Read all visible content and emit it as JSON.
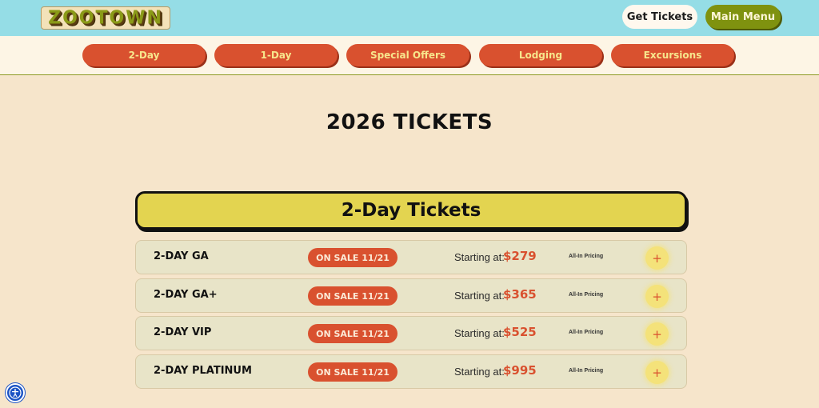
{
  "header": {
    "logo_text": "ZOOTOWN",
    "get_tickets_label": "Get Tickets",
    "main_menu_label": "Main Menu"
  },
  "nav": {
    "items": [
      {
        "label": "2-Day"
      },
      {
        "label": "1-Day"
      },
      {
        "label": "Special Offers"
      },
      {
        "label": "Lodging"
      },
      {
        "label": "Excursions"
      }
    ]
  },
  "main": {
    "page_title": "2026 TICKETS",
    "section_title": "2-Day Tickets",
    "tickets": [
      {
        "name": "2-DAY GA",
        "badge": "ON SALE 11/21",
        "starting_label": "Starting at:",
        "price": "$279",
        "pricing_note": "All-In Pricing",
        "expand_symbol": "+"
      },
      {
        "name": "2-DAY GA+",
        "badge": "ON SALE 11/21",
        "starting_label": "Starting at:",
        "price": "$365",
        "pricing_note": "All-In Pricing",
        "expand_symbol": "+"
      },
      {
        "name": "2-DAY VIP",
        "badge": "ON SALE 11/21",
        "starting_label": "Starting at:",
        "price": "$525",
        "pricing_note": "All-In Pricing",
        "expand_symbol": "+"
      },
      {
        "name": "2-DAY PLATINUM",
        "badge": "ON SALE 11/21",
        "starting_label": "Starting at:",
        "price": "$995",
        "pricing_note": "All-In Pricing",
        "expand_symbol": "+"
      }
    ]
  },
  "icons": {
    "accessibility": "accessibility-icon"
  },
  "colors": {
    "header_bg": "#95dde6",
    "accent_orange": "#d9512f",
    "section_yellow": "#e3d450",
    "menu_green": "#7f920f",
    "page_bg": "#f6e5cb"
  }
}
